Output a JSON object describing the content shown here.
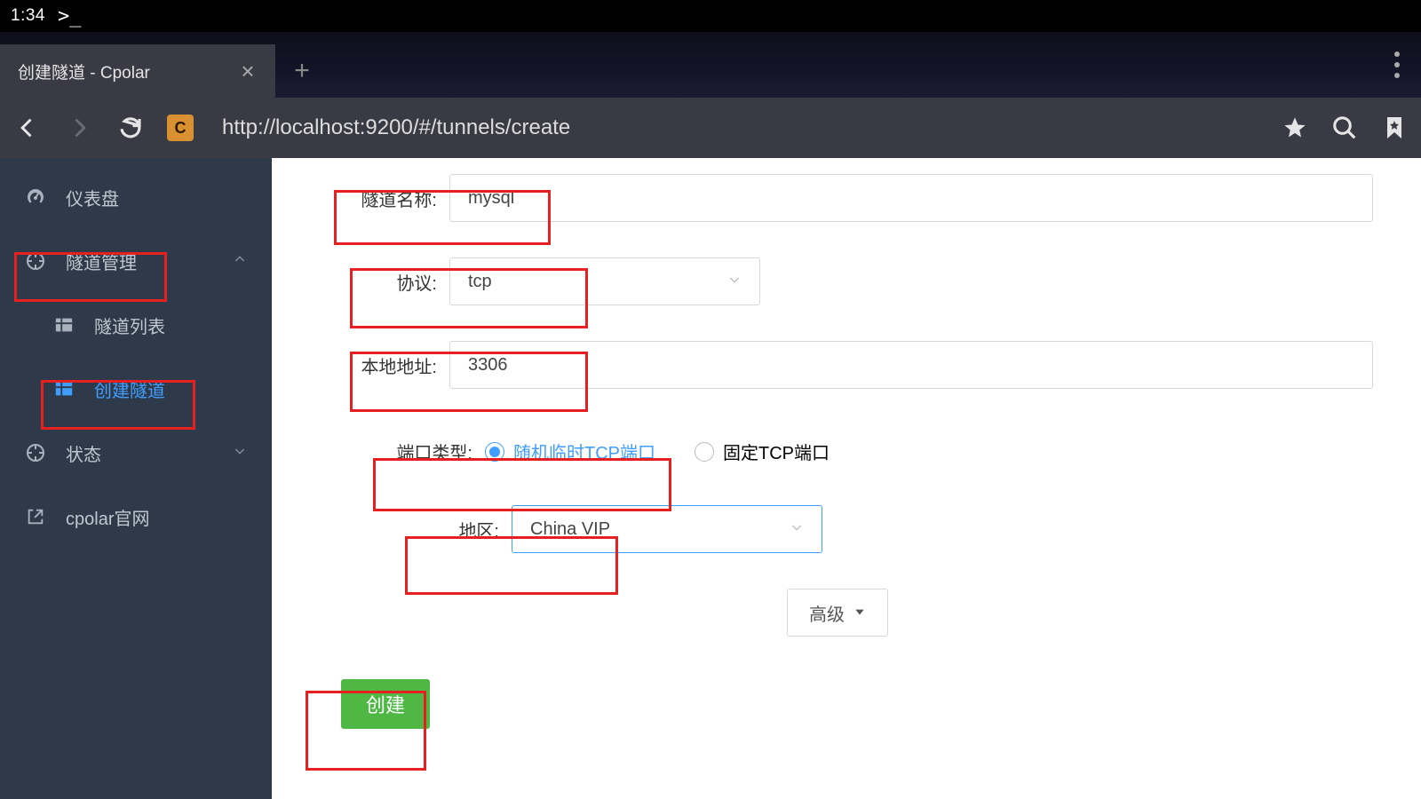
{
  "status": {
    "time": "1:34",
    "terminal_prompt": ">_"
  },
  "browser": {
    "tab_title": "创建隧道 - Cpolar",
    "site_badge": "C",
    "url": "http://localhost:9200/#/tunnels/create"
  },
  "sidebar": {
    "dashboard": "仪表盘",
    "tunnel_mgmt": "隧道管理",
    "tunnel_list": "隧道列表",
    "create_tunnel": "创建隧道",
    "status": "状态",
    "cpolar_site": "cpolar官网"
  },
  "form": {
    "name_label": "隧道名称:",
    "name_value": "mysql",
    "protocol_label": "协议:",
    "protocol_value": "tcp",
    "local_addr_label": "本地地址:",
    "local_addr_value": "3306",
    "port_type_label": "端口类型:",
    "port_type_random": "随机临时TCP端口",
    "port_type_fixed": "固定TCP端口",
    "region_label": "地区:",
    "region_value": "China VIP",
    "advanced": "高级",
    "create": "创建"
  }
}
